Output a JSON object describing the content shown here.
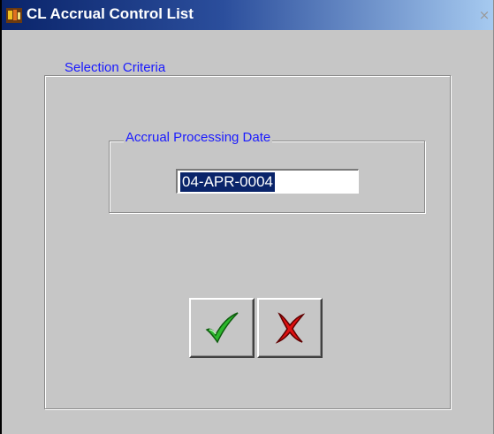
{
  "window": {
    "title": "CL Accrual Control List",
    "close_glyph": "×",
    "app_icon": "oracle-forms-app-icon"
  },
  "selection": {
    "label": "Selection Criteria",
    "date_group": {
      "label": "Accrual Processing Date",
      "value": "04-APR-0004"
    }
  },
  "buttons": {
    "ok": {
      "icon": "green-checkmark-icon",
      "color": "#2db82d"
    },
    "cancel": {
      "icon": "red-x-icon",
      "color": "#e01010"
    }
  },
  "colors": {
    "title_bar_start": "#0a246a",
    "title_bar_end": "#a6caf0",
    "window_bg": "#c6c6c6",
    "label_text": "#1a1aff"
  }
}
